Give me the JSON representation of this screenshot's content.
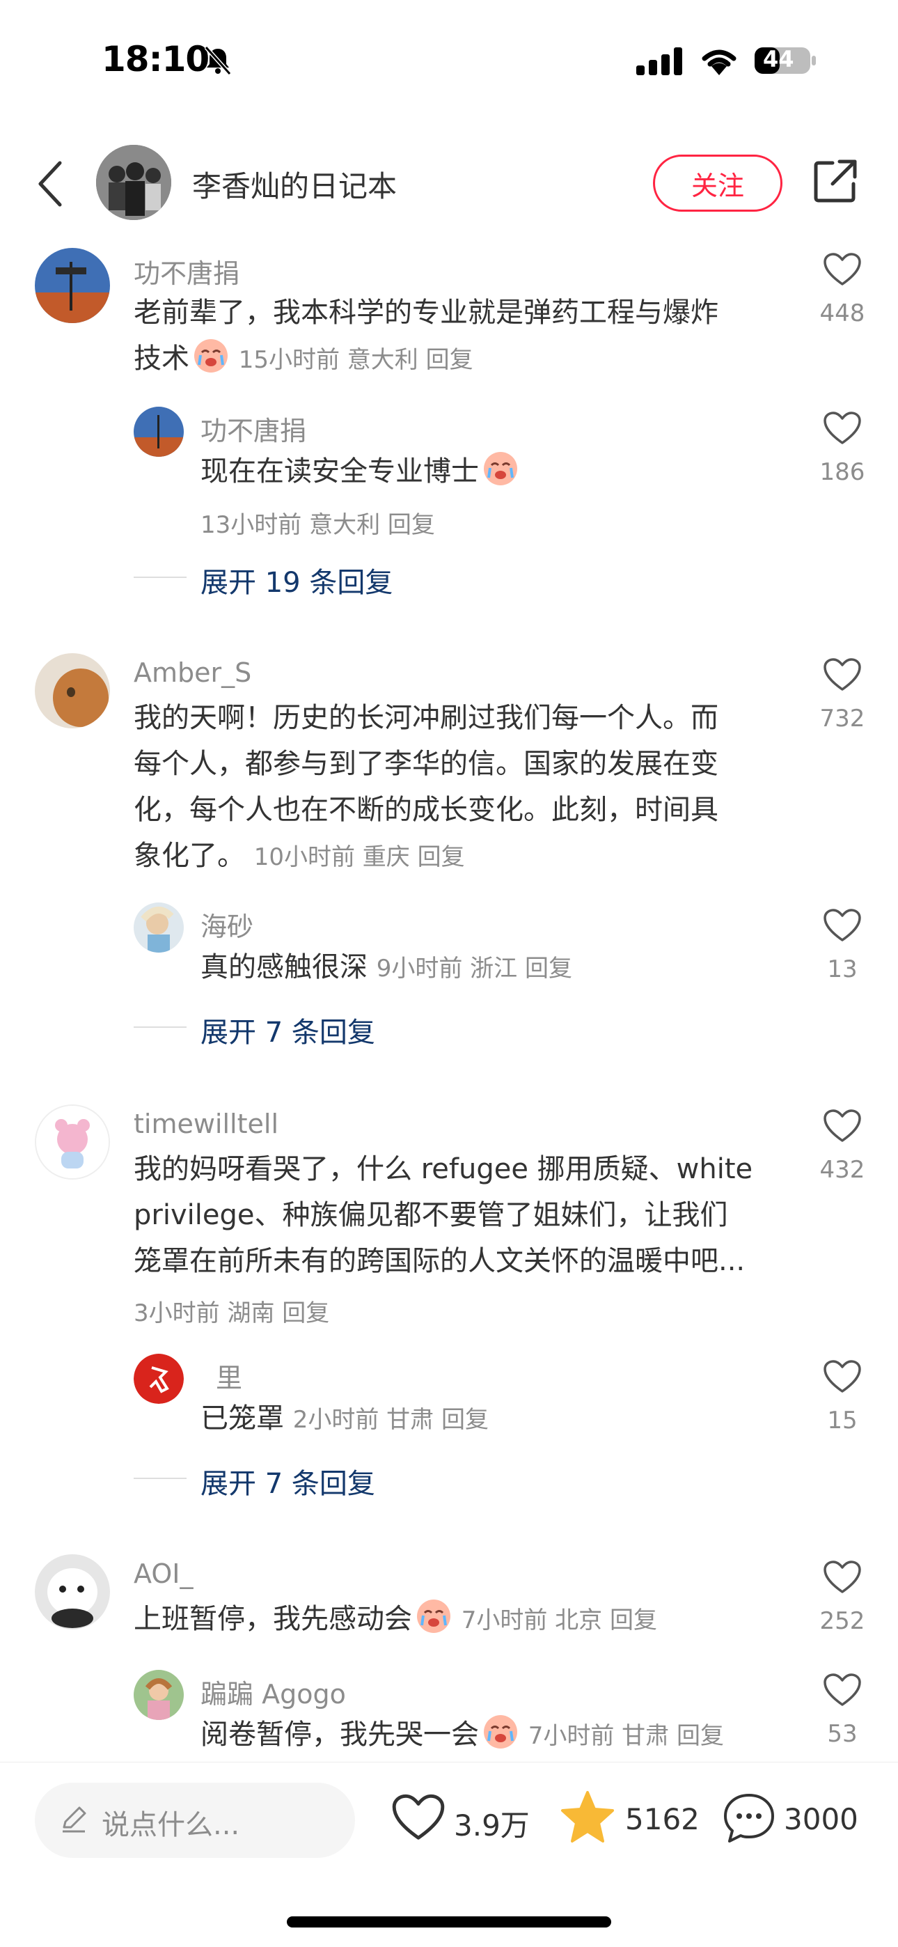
{
  "status_bar": {
    "time": "18:10",
    "battery": "44"
  },
  "header": {
    "author": "李香灿的日记本",
    "follow_label": "关注"
  },
  "comments": [
    {
      "user": "功不唐捐",
      "text_line1": "老前辈了，我本科学的专业就是弹药工程与爆炸",
      "text_line2": "技术",
      "meta": "15小时前 意大利 回复",
      "likes": "448",
      "reply": {
        "user": "功不唐捐",
        "text": "现在在读安全专业博士",
        "meta": "13小时前 意大利 回复",
        "likes": "186"
      },
      "expand": "展开 19 条回复"
    },
    {
      "user": "Amber_S",
      "text_line1": "我的天啊！历史的长河冲刷过我们每一个人。而",
      "text_line2": "每个人，都参与到了李华的信。国家的发展在变",
      "text_line3": "化，每个人也在不断的成长变化。此刻，时间具",
      "text_line4": "象化了。",
      "meta": "10小时前 重庆 回复",
      "likes": "732",
      "reply": {
        "user": "海砂",
        "text": "真的感触很深",
        "meta": "9小时前 浙江 回复",
        "likes": "13"
      },
      "expand": "展开 7 条回复"
    },
    {
      "user": "timewilltell",
      "text_line1": "我的妈呀看哭了，什么 refugee 挪用质疑、white",
      "text_line2": "privilege、种族偏见都不要管了姐妹们，让我们",
      "text_line3": "笼罩在前所未有的跨国际的人文关怀的温暖中吧...",
      "meta": "3小时前 湖南 回复",
      "likes": "432",
      "reply": {
        "user": "里",
        "text": "已笼罩",
        "meta": "2小时前 甘肃 回复",
        "likes": "15"
      },
      "expand": "展开 7 条回复"
    },
    {
      "user": "AOI_",
      "text_line1": "上班暂停，我先感动会",
      "meta": "7小时前 北京 回复",
      "likes": "252",
      "reply": {
        "user": "蹁蹁 Agogo",
        "text": "阅卷暂停，我先哭一会",
        "meta": "7小时前 甘肃 回复",
        "likes": "53"
      }
    }
  ],
  "bottom_bar": {
    "input_placeholder": "说点什么...",
    "likes": "3.9万",
    "stars": "5162",
    "comments": "3000"
  },
  "icons": [
    "bell-slash-icon",
    "signal-icon",
    "wifi-icon",
    "battery-icon",
    "back-icon",
    "share-icon",
    "heart-icon",
    "pencil-icon",
    "star-icon",
    "comment-icon"
  ],
  "colors": {
    "accent": "#ff2442",
    "link": "#13386c",
    "secondary_text": "#8c8c8c",
    "star": "#f8b936"
  }
}
